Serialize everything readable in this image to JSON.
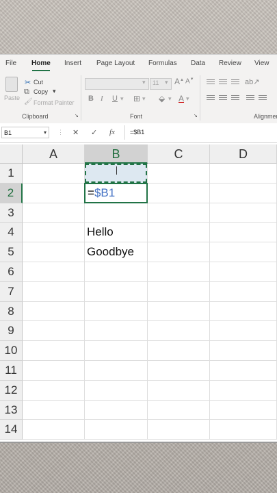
{
  "tabs": {
    "file": "File",
    "home": "Home",
    "insert": "Insert",
    "page_layout": "Page Layout",
    "formulas": "Formulas",
    "data": "Data",
    "review": "Review",
    "view": "View"
  },
  "clipboard": {
    "paste": "Paste",
    "cut": "Cut",
    "copy": "Copy",
    "format_painter": "Format Painter",
    "label": "Clipboard"
  },
  "font": {
    "size": "11",
    "bold": "B",
    "italic": "I",
    "underline": "U",
    "label": "Font"
  },
  "alignment": {
    "label": "Alignmen"
  },
  "formula_bar": {
    "name_box": "B1",
    "formula": "=$B1"
  },
  "columns": [
    "A",
    "B",
    "C",
    "D"
  ],
  "rows": [
    "1",
    "2",
    "3",
    "4",
    "5",
    "6",
    "7",
    "8",
    "9",
    "10",
    "11",
    "12",
    "13",
    "14"
  ],
  "cells": {
    "b2_eq": "=",
    "b2_ref": "$B1",
    "b4": "Hello",
    "b5": "Goodbye"
  },
  "colors": {
    "accent": "#217346",
    "reference": "#4472c4",
    "marquee_fill": "#dde8f1"
  }
}
